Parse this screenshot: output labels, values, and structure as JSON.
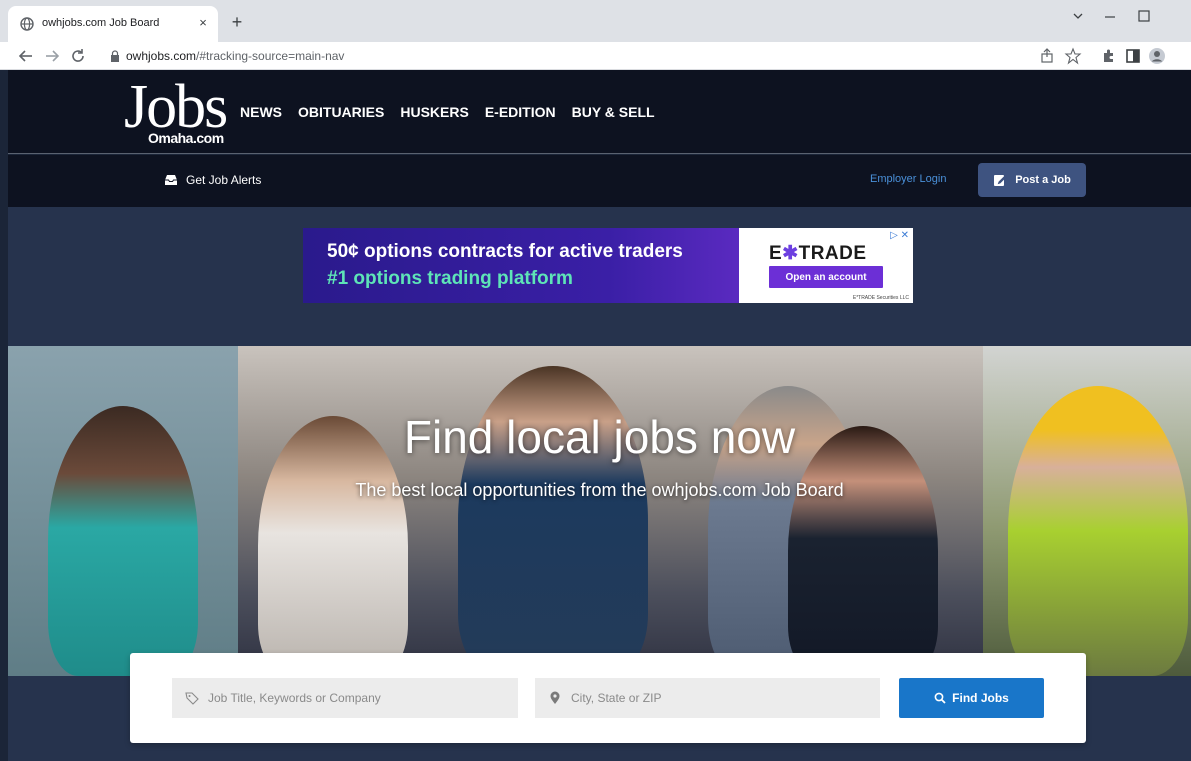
{
  "browser": {
    "tab_title": "owhjobs.com Job Board",
    "tab_close": "×",
    "new_tab": "+",
    "url_host": "owhjobs.com",
    "url_path": "/#tracking-source=main-nav"
  },
  "header": {
    "logo_main": "Jobs",
    "logo_sub": "Omaha.com",
    "nav": [
      "NEWS",
      "OBITUARIES",
      "HUSKERS",
      "E-EDITION",
      "BUY & SELL"
    ]
  },
  "subbar": {
    "alerts_label": "Get Job Alerts",
    "employer_login": "Employer Login",
    "post_job": "Post a Job"
  },
  "ad": {
    "line1": "50¢ options contracts for active traders",
    "line2": "#1 options trading platform",
    "brand_a": "E",
    "brand_star": "✱",
    "brand_b": "TRADE",
    "cta": "Open an account",
    "legal": "E*TRADE Securities LLC",
    "choices": "▷ ✕"
  },
  "hero": {
    "title": "Find local jobs now",
    "subtitle": "The best local opportunities from the owhjobs.com Job Board"
  },
  "search": {
    "keyword_placeholder": "Job Title, Keywords or Company",
    "location_placeholder": "City, State or ZIP",
    "button_label": "Find Jobs"
  },
  "colors": {
    "header_bg": "#0d1220",
    "band_bg": "#26334d",
    "post_button": "#3e5380",
    "find_button": "#1976c9",
    "link": "#4a90d9"
  }
}
